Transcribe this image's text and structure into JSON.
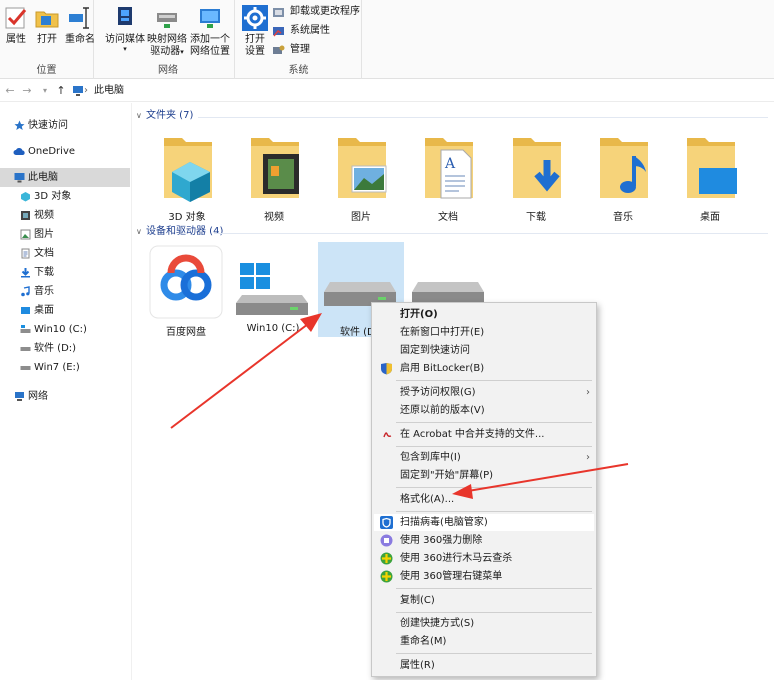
{
  "ribbon": {
    "location": {
      "label": "位置",
      "buttons": [
        {
          "label": "属性",
          "icon": "checkmark-properties-icon"
        },
        {
          "label": "打开",
          "icon": "open-folder-icon"
        },
        {
          "label": "重命名",
          "icon": "rename-icon"
        }
      ]
    },
    "network": {
      "label": "网络",
      "buttons": [
        {
          "label": "访问媒体",
          "icon": "media-icon",
          "has_dropdown": true
        },
        {
          "label": "映射网络驱动器",
          "line1": "映射网络",
          "line2": "驱动器",
          "icon": "map-drive-icon",
          "has_dropdown": true
        },
        {
          "label": "添加一个网络位置",
          "line1": "添加一个",
          "line2": "网络位置",
          "icon": "network-location-icon"
        }
      ]
    },
    "system": {
      "label": "系统",
      "open_settings": {
        "line1": "打开",
        "line2": "设置",
        "icon": "gear-icon"
      },
      "items": [
        {
          "label": "卸载或更改程序",
          "icon": "uninstall-icon"
        },
        {
          "label": "系统属性",
          "icon": "system-properties-icon"
        },
        {
          "label": "管理",
          "icon": "manage-icon"
        }
      ]
    }
  },
  "address_bar": {
    "breadcrumb": [
      "此电脑"
    ]
  },
  "sidebar": {
    "items": [
      {
        "label": "快速访问",
        "icon": "star-icon"
      },
      {
        "label": "OneDrive",
        "icon": "cloud-icon"
      },
      {
        "label": "此电脑",
        "icon": "computer-icon",
        "selected": true
      },
      {
        "label": "3D 对象",
        "icon": "3d-objects-icon"
      },
      {
        "label": "视频",
        "icon": "video-icon"
      },
      {
        "label": "图片",
        "icon": "pictures-icon"
      },
      {
        "label": "文档",
        "icon": "documents-icon"
      },
      {
        "label": "下载",
        "icon": "downloads-icon"
      },
      {
        "label": "音乐",
        "icon": "music-icon"
      },
      {
        "label": "桌面",
        "icon": "desktop-icon"
      },
      {
        "label": "Win10 (C:)",
        "icon": "system-drive-icon"
      },
      {
        "label": "软件 (D:)",
        "icon": "drive-icon"
      },
      {
        "label": "Win7 (E:)",
        "icon": "drive-icon"
      },
      {
        "label": "网络",
        "icon": "network-icon"
      }
    ]
  },
  "folders": {
    "header": "文件夹 (7)",
    "items": [
      {
        "label": "3D 对象",
        "icon": "3d-objects-folder-icon"
      },
      {
        "label": "视频",
        "icon": "video-folder-icon"
      },
      {
        "label": "图片",
        "icon": "pictures-folder-icon"
      },
      {
        "label": "文档",
        "icon": "documents-folder-icon"
      },
      {
        "label": "下载",
        "icon": "downloads-folder-icon"
      },
      {
        "label": "音乐",
        "icon": "music-folder-icon"
      },
      {
        "label": "桌面",
        "icon": "desktop-folder-icon"
      }
    ]
  },
  "devices": {
    "header": "设备和驱动器 (4)",
    "items": [
      {
        "label": "百度网盘",
        "icon": "baidu-netdisk-icon"
      },
      {
        "label": "Win10 (C:)",
        "icon": "system-drive-icon"
      },
      {
        "label": "软件 (D:)",
        "icon": "drive-icon",
        "selected": true
      },
      {
        "label": "",
        "icon": "drive-icon"
      }
    ]
  },
  "context_menu": {
    "items": [
      {
        "label": "打开(O)",
        "bold": true
      },
      {
        "label": "在新窗口中打开(E)"
      },
      {
        "label": "固定到快速访问"
      },
      {
        "label": "启用 BitLocker(B)",
        "icon": "shield-icon"
      },
      {
        "label": "授予访问权限(G)",
        "submenu": true
      },
      {
        "label": "还原以前的版本(V)"
      },
      {
        "label": "在 Acrobat 中合并支持的文件...",
        "icon": "acrobat-icon"
      },
      {
        "label": "包含到库中(I)",
        "submenu": true
      },
      {
        "label": "固定到\"开始\"屏幕(P)"
      },
      {
        "label": "格式化(A)..."
      },
      {
        "label": "扫描病毒(电脑管家)",
        "icon": "tencent-guard-icon",
        "highlighted": true
      },
      {
        "label": "使用 360强力删除",
        "icon": "360-delete-icon"
      },
      {
        "label": "使用 360进行木马云查杀",
        "icon": "360-scan-icon"
      },
      {
        "label": "使用 360管理右键菜单",
        "icon": "360-menu-icon"
      },
      {
        "label": "复制(C)"
      },
      {
        "label": "创建快捷方式(S)"
      },
      {
        "label": "重命名(M)"
      },
      {
        "label": "属性(R)"
      }
    ]
  },
  "colors": {
    "accent": "#0078d7",
    "folder": "#f4c95d",
    "selection": "#cce4f7",
    "annotation_arrow": "#e8352b"
  }
}
